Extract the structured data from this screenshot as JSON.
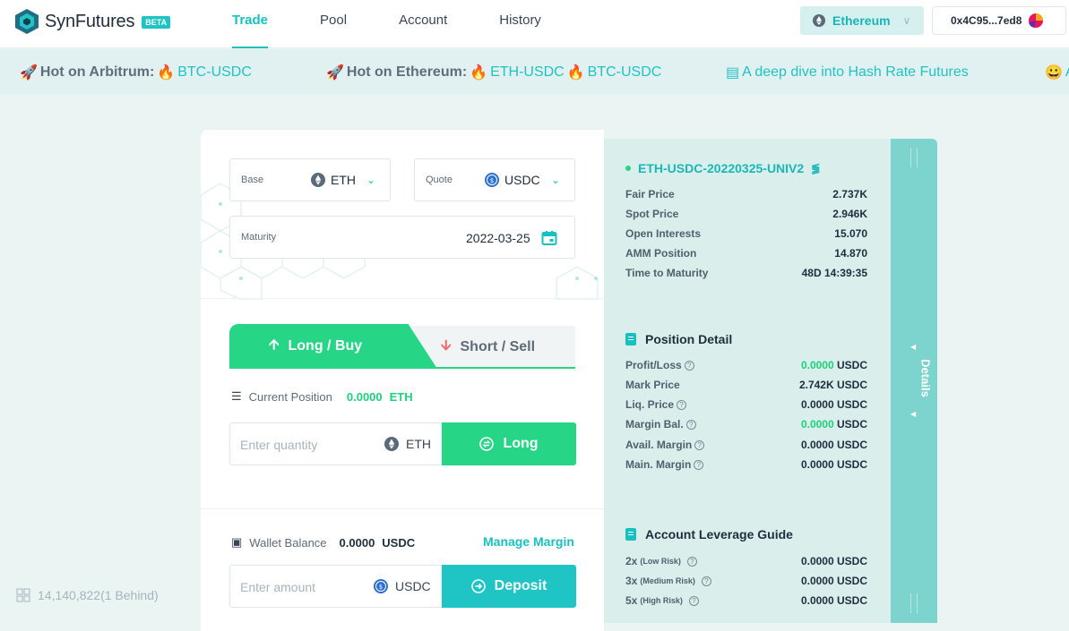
{
  "header": {
    "brand": "SynFutures",
    "beta": "BETA",
    "nav": [
      "Trade",
      "Pool",
      "Account",
      "History"
    ],
    "network": "Ethereum",
    "address": "0x4C95...7ed8"
  },
  "ticker": {
    "items": [
      {
        "label": "Hot on Arbitrum:",
        "pairs": [
          "BTC-USDC"
        ]
      },
      {
        "label": "Hot on Ethereum:",
        "pairs": [
          "ETH-USDC",
          "BTC-USDC"
        ]
      },
      {
        "article": "A deep dive into Hash Rate Futures"
      },
      {
        "partial": "A"
      }
    ]
  },
  "form": {
    "base_label": "Base",
    "base_value": "ETH",
    "quote_label": "Quote",
    "quote_value": "USDC",
    "maturity_label": "Maturity",
    "maturity_value": "2022-03-25",
    "tab_long": "Long / Buy",
    "tab_short": "Short / Sell",
    "current_position_label": "Current Position",
    "current_position_value": "0.0000",
    "current_position_unit": "ETH",
    "quantity_placeholder": "Enter quantity",
    "quantity_unit": "ETH",
    "long_button": "Long",
    "wallet_label": "Wallet Balance",
    "wallet_value": "0.0000",
    "wallet_unit": "USDC",
    "manage_margin": "Manage Margin",
    "amount_placeholder": "Enter amount",
    "amount_unit": "USDC",
    "deposit_button": "Deposit"
  },
  "info": {
    "pair": "ETH-USDC-20220325-UNIV2",
    "stats": [
      {
        "k": "Fair Price",
        "v": "2.737K"
      },
      {
        "k": "Spot Price",
        "v": "2.946K"
      },
      {
        "k": "Open Interests",
        "v": "15.070"
      },
      {
        "k": "AMM Position",
        "v": "14.870"
      },
      {
        "k": "Time to Maturity",
        "v": "48D 14:39:35"
      }
    ],
    "position_title": "Position Detail",
    "position": [
      {
        "k": "Profit/Loss",
        "v": "0.0000",
        "u": "USDC"
      },
      {
        "k": "Mark Price",
        "v": "2.742K",
        "u": "USDC"
      },
      {
        "k": "Liq. Price",
        "v": "0.0000",
        "u": "USDC"
      },
      {
        "k": "Margin Bal.",
        "v": "0.0000",
        "u": "USDC"
      },
      {
        "k": "Avail. Margin",
        "v": "0.0000",
        "u": "USDC"
      },
      {
        "k": "Main. Margin",
        "v": "0.0000",
        "u": "USDC"
      }
    ],
    "leverage_title": "Account Leverage Guide",
    "leverage": [
      {
        "k": "2x",
        "risk": "(Low Risk)",
        "v": "0.0000",
        "u": "USDC"
      },
      {
        "k": "3x",
        "risk": "(Medium Risk)",
        "v": "0.0000",
        "u": "USDC"
      },
      {
        "k": "5x",
        "risk": "(High Risk)",
        "v": "0.0000",
        "u": "USDC"
      }
    ],
    "details_tab": "Details"
  },
  "footer": {
    "block": "14,140,822(1 Behind)"
  },
  "colors": {
    "accent": "#19c0c0",
    "long": "#26d585",
    "short": "#f26a6a"
  }
}
